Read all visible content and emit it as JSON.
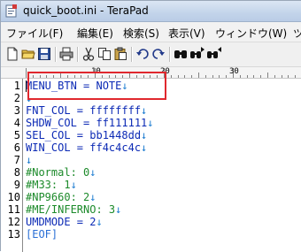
{
  "window": {
    "title": "quick_boot.ini - TeraPad"
  },
  "menu": [
    {
      "label": "ファイル(F)"
    },
    {
      "label": "編集(E)"
    },
    {
      "label": "検索(S)"
    },
    {
      "label": "表示(V)"
    },
    {
      "label": "ウィンドウ(W)"
    },
    {
      "label": "ツ"
    }
  ],
  "ruler": {
    "labels": [
      "10",
      "20",
      "30"
    ]
  },
  "editor": {
    "lines": [
      {
        "num": "1",
        "text": "MENU_BTN = NOTE",
        "kind": "kw"
      },
      {
        "num": "2",
        "text": "",
        "kind": "kw"
      },
      {
        "num": "3",
        "text": "FNT_COL = ffffffff",
        "kind": "kw"
      },
      {
        "num": "4",
        "text": "SHDW_COL = ff111111",
        "kind": "kw"
      },
      {
        "num": "5",
        "text": "SEL_COL = bb1448dd",
        "kind": "kw"
      },
      {
        "num": "6",
        "text": "WIN_COL = ff4c4c4c",
        "kind": "kw"
      },
      {
        "num": "7",
        "text": "",
        "kind": "kw"
      },
      {
        "num": "8",
        "text": "#Normal: 0",
        "kind": "cm"
      },
      {
        "num": "9",
        "text": "#M33: 1",
        "kind": "cm"
      },
      {
        "num": "10",
        "text": "#NP9660: 2",
        "kind": "cm"
      },
      {
        "num": "11",
        "text": "#ME/INFERNO: 3",
        "kind": "cm"
      },
      {
        "num": "12",
        "text": "UMDMODE = 2",
        "kind": "kw"
      },
      {
        "num": "13",
        "text": "[EOF]",
        "kind": "eof"
      }
    ],
    "newline_marker": "↓"
  },
  "colors": {
    "keyword": "#0c2ab5",
    "comment": "#1c8a2a",
    "newline": "#1b7bd0",
    "eof": "#2a6fd6",
    "highlight_box": "#e0282e"
  },
  "toolbar_icons": [
    "new-file-icon",
    "open-folder-icon",
    "save-icon",
    "print-icon",
    "cut-icon",
    "copy-icon",
    "paste-icon",
    "undo-icon",
    "redo-icon",
    "find-icon",
    "find-next-icon",
    "find-prev-icon"
  ]
}
